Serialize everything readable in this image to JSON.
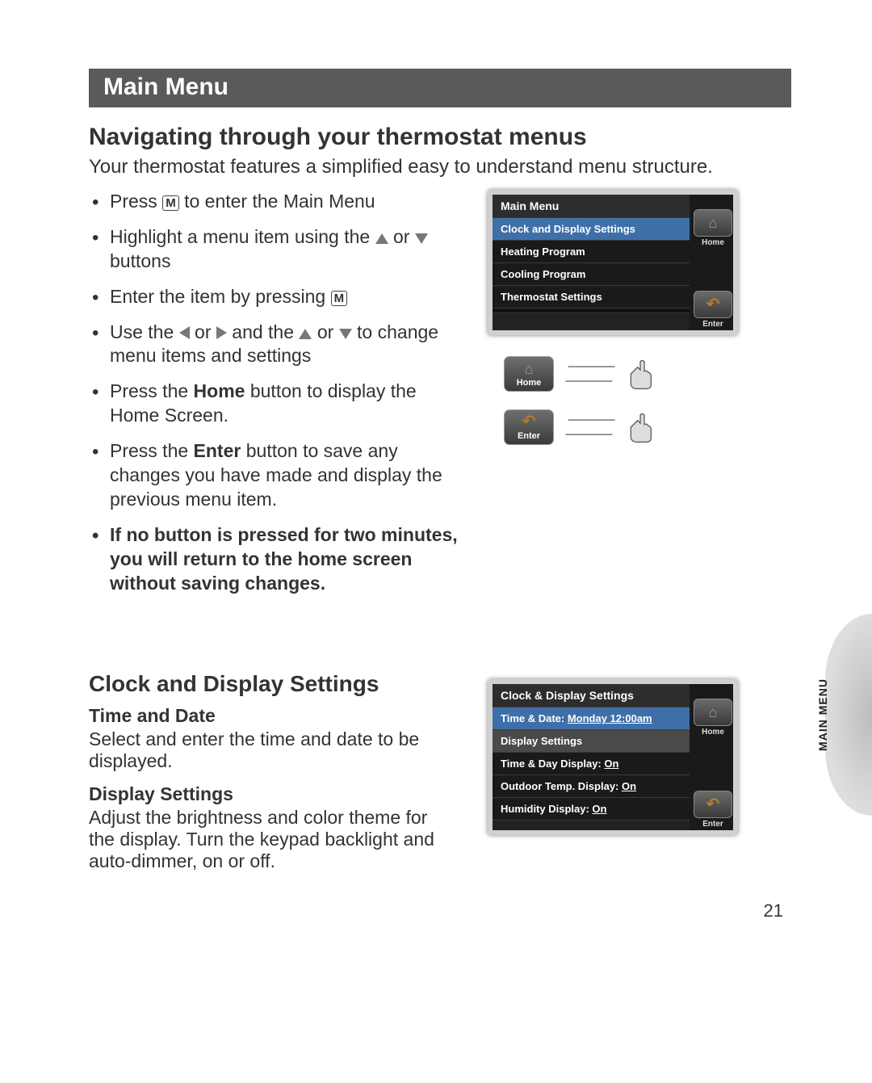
{
  "section_bar": "Main Menu",
  "subtitle": "Navigating through your thermostat menus",
  "lead": "Your thermostat features a simplified easy to understand menu structure.",
  "bullets": {
    "b1a": "Press ",
    "b1b": " to enter the Main Menu",
    "b2a": "Highlight a menu item using the ",
    "b2_or": " or ",
    "b2c": " buttons",
    "b3a": "Enter the item by pressing ",
    "b4a": "Use the ",
    "b4_and": " and the ",
    "b4b": " to change menu items and settings",
    "b5a": "Press the ",
    "b5_home": "Home",
    "b5b": " button to display the Home Screen.",
    "b6a": "Press the ",
    "b6_enter": "Enter",
    "b6b": " button to save any changes you have made and display the previous menu item.",
    "b7": "If no button is pressed for two minutes, you will return to the home screen without saving changes."
  },
  "key_M": "M",
  "thermo1": {
    "title": "Main Menu",
    "items": [
      "Clock and Display Settings",
      "Heating Program",
      "Cooling Program",
      "Thermostat Settings"
    ],
    "home": "Home",
    "enter": "Enter"
  },
  "btn_ill": {
    "home": "Home",
    "enter": "Enter"
  },
  "sec2_title": "Clock and Display Settings",
  "sec2_sub1": "Time and Date",
  "sec2_p1": "Select and enter the time and date to be displayed.",
  "sec2_sub2": "Display Settings",
  "sec2_p2": "Adjust the brightness and color theme for the display. Turn the keypad backlight and auto-dimmer, on or off.",
  "thermo2": {
    "title": "Clock & Display Settings",
    "row1_label": "Time & Date: ",
    "row1_value": "Monday 12:00am",
    "sub": "Display Settings",
    "row2_label": "Time & Day Display: ",
    "row2_value": "On",
    "row3_label": "Outdoor Temp. Display: ",
    "row3_value": "On",
    "row4_label": "Humidity Display: ",
    "row4_value": "On",
    "home": "Home",
    "enter": "Enter"
  },
  "side_tab": "MAIN MENU",
  "page_number": "21"
}
